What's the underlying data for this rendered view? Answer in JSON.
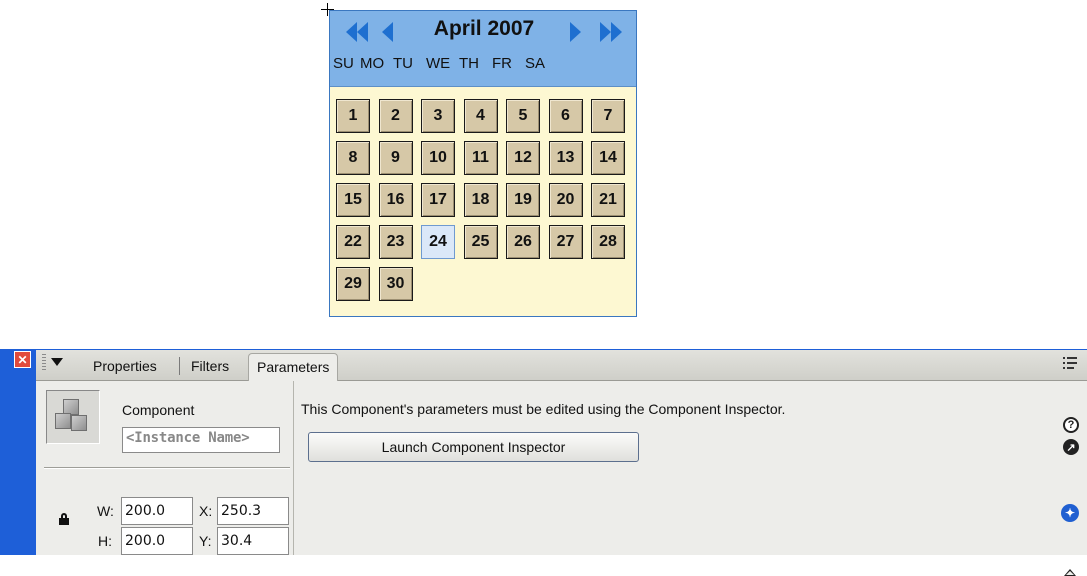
{
  "calendar": {
    "month_title": "April 2007",
    "weekdays": [
      "SU",
      "MO",
      "TU",
      "WE",
      "TH",
      "FR",
      "SA"
    ],
    "weeks": [
      [
        "1",
        "2",
        "3",
        "4",
        "5",
        "6",
        "7"
      ],
      [
        "8",
        "9",
        "10",
        "11",
        "12",
        "13",
        "14"
      ],
      [
        "15",
        "16",
        "17",
        "18",
        "19",
        "20",
        "21"
      ],
      [
        "22",
        "23",
        "24",
        "25",
        "26",
        "27",
        "28"
      ],
      [
        "29",
        "30"
      ]
    ],
    "selected_day": "24",
    "colors": {
      "header": "#7fb2e7",
      "day_cell": "#d6c8a7",
      "today_cell": "#dbe8f8",
      "nav_arrow": "#1e6fd0",
      "body": "#fdf8d2"
    },
    "icons": {
      "first": "double-left-arrow-icon",
      "prev": "left-arrow-icon",
      "next": "right-arrow-icon",
      "last": "double-right-arrow-icon"
    }
  },
  "panel": {
    "tabs": [
      {
        "label": "Properties"
      },
      {
        "label": "Filters"
      },
      {
        "label": "Parameters",
        "active": true
      }
    ],
    "component_label": "Component",
    "instance_name_placeholder": "<Instance Name>",
    "width_label": "W:",
    "width_value": "200.0",
    "height_label": "H:",
    "height_value": "200.0",
    "x_label": "X:",
    "x_value": "250.3",
    "y_label": "Y:",
    "y_value": "30.4",
    "message": "This Component's parameters must be edited using the Component Inspector.",
    "launch_button_label": "Launch Component Inspector",
    "colors": {
      "frame": "#1e5fd8",
      "body": "#ededea",
      "close": "#e14b3c"
    },
    "icons": [
      "close-icon",
      "gripper-icon",
      "collapse-arrow-icon",
      "options-menu-icon",
      "component-icon",
      "lock-icon",
      "help-icon",
      "goto-icon",
      "accessibility-icon",
      "expand-icon"
    ]
  }
}
